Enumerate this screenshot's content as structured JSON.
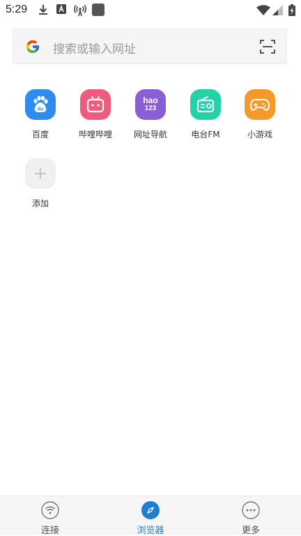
{
  "status_bar": {
    "time": "5:29"
  },
  "search": {
    "placeholder": "搜索或输入网址"
  },
  "shortcuts": [
    {
      "label": "百度",
      "color": "#2d8cf0",
      "icon": "baidu-paw-icon"
    },
    {
      "label": "哔哩哔哩",
      "color": "#ef5b7a",
      "icon": "bilibili-tv-icon"
    },
    {
      "label": "网址导航",
      "color": "#8a5fd6",
      "icon": "hao123-icon",
      "icon_text_top": "hao",
      "icon_text_bottom": "123"
    },
    {
      "label": "电台FM",
      "color": "#22d3a8",
      "icon": "radio-icon"
    },
    {
      "label": "小游戏",
      "color": "#f59a2a",
      "icon": "gamepad-icon"
    },
    {
      "label": "添加",
      "color": "#f0f0f0",
      "icon": "plus-icon"
    }
  ],
  "bottom_nav": {
    "items": [
      {
        "label": "连接",
        "icon": "wifi-icon",
        "active": false
      },
      {
        "label": "浏览器",
        "icon": "compass-icon",
        "active": true,
        "color": "#1e7fd0"
      },
      {
        "label": "更多",
        "icon": "more-icon",
        "active": false
      }
    ]
  }
}
